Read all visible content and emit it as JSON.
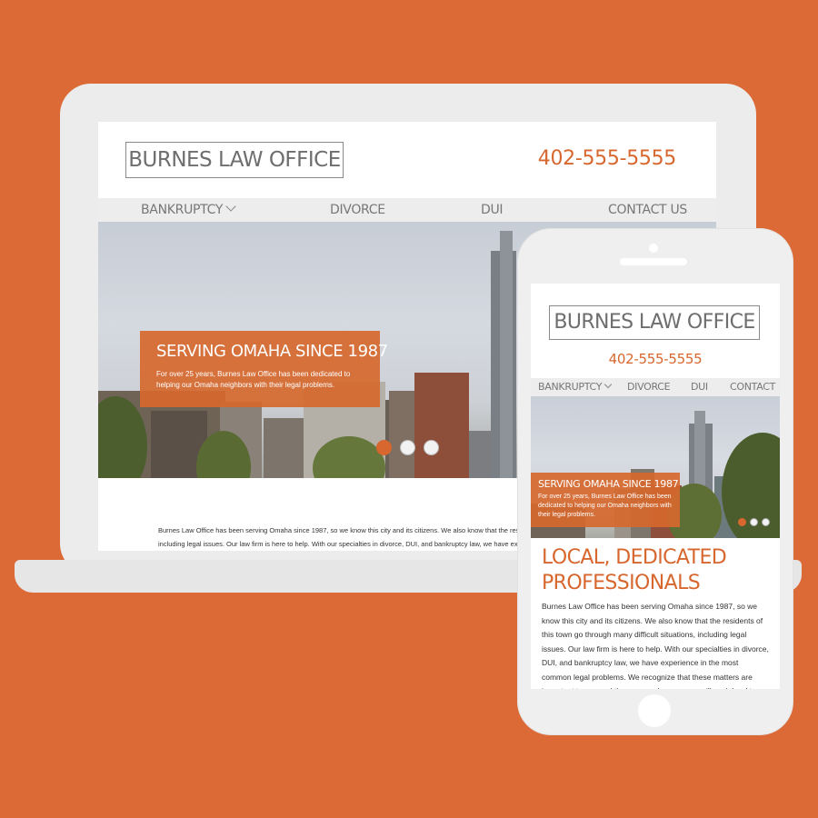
{
  "colors": {
    "background": "#dc6a36",
    "accent": "#d7672e",
    "nav_bg": "#ededed",
    "device": "#ececec"
  },
  "desktop": {
    "logo": "BURNES LAW OFFICE",
    "phone": "402-555-5555",
    "nav": [
      "BANKRUPTCY",
      "DIVORCE",
      "DUI",
      "CONTACT US"
    ],
    "hero": {
      "title": "SERVING OMAHA SINCE 1987",
      "text": "For over 25 years, Burnes Law Office has been dedicated to helping our Omaha neighbors with their legal problems.",
      "active_slide": 1,
      "slide_count": 3
    },
    "body": "Burnes Law Office has been serving Omaha since 1987, so we know this city and its citizens. We also know that the residents of this town go through many difficult situations, including legal issues. Our law firm is here to help. With our specialties in divorce, DUI, and bankruptcy law, we have experience in the most common legal problems."
  },
  "mobile": {
    "logo": "BURNES LAW OFFICE",
    "phone": "402-555-5555",
    "nav": [
      "BANKRUPTCY",
      "DIVORCE",
      "DUI",
      "CONTACT"
    ],
    "hero": {
      "title": "SERVING OMAHA SINCE 1987",
      "text": "For over 25 years, Burnes Law Office has been dedicated to helping our Omaha neighbors with their legal problems.",
      "active_slide": 1,
      "slide_count": 3
    },
    "heading": "LOCAL, DEDICATED PROFESSIONALS",
    "body": "Burnes Law Office has been serving Omaha since 1987, so we know this city and its citizens. We also know that the residents of this town go through many difficult situations, including legal issues. Our law firm is here to help. With our specialties in divorce, DUI, and bankruptcy law, we have experience in the most common legal problems. We recognize that these matters are important to you and those around you, so we will work hard to preserve your relationships and"
  }
}
